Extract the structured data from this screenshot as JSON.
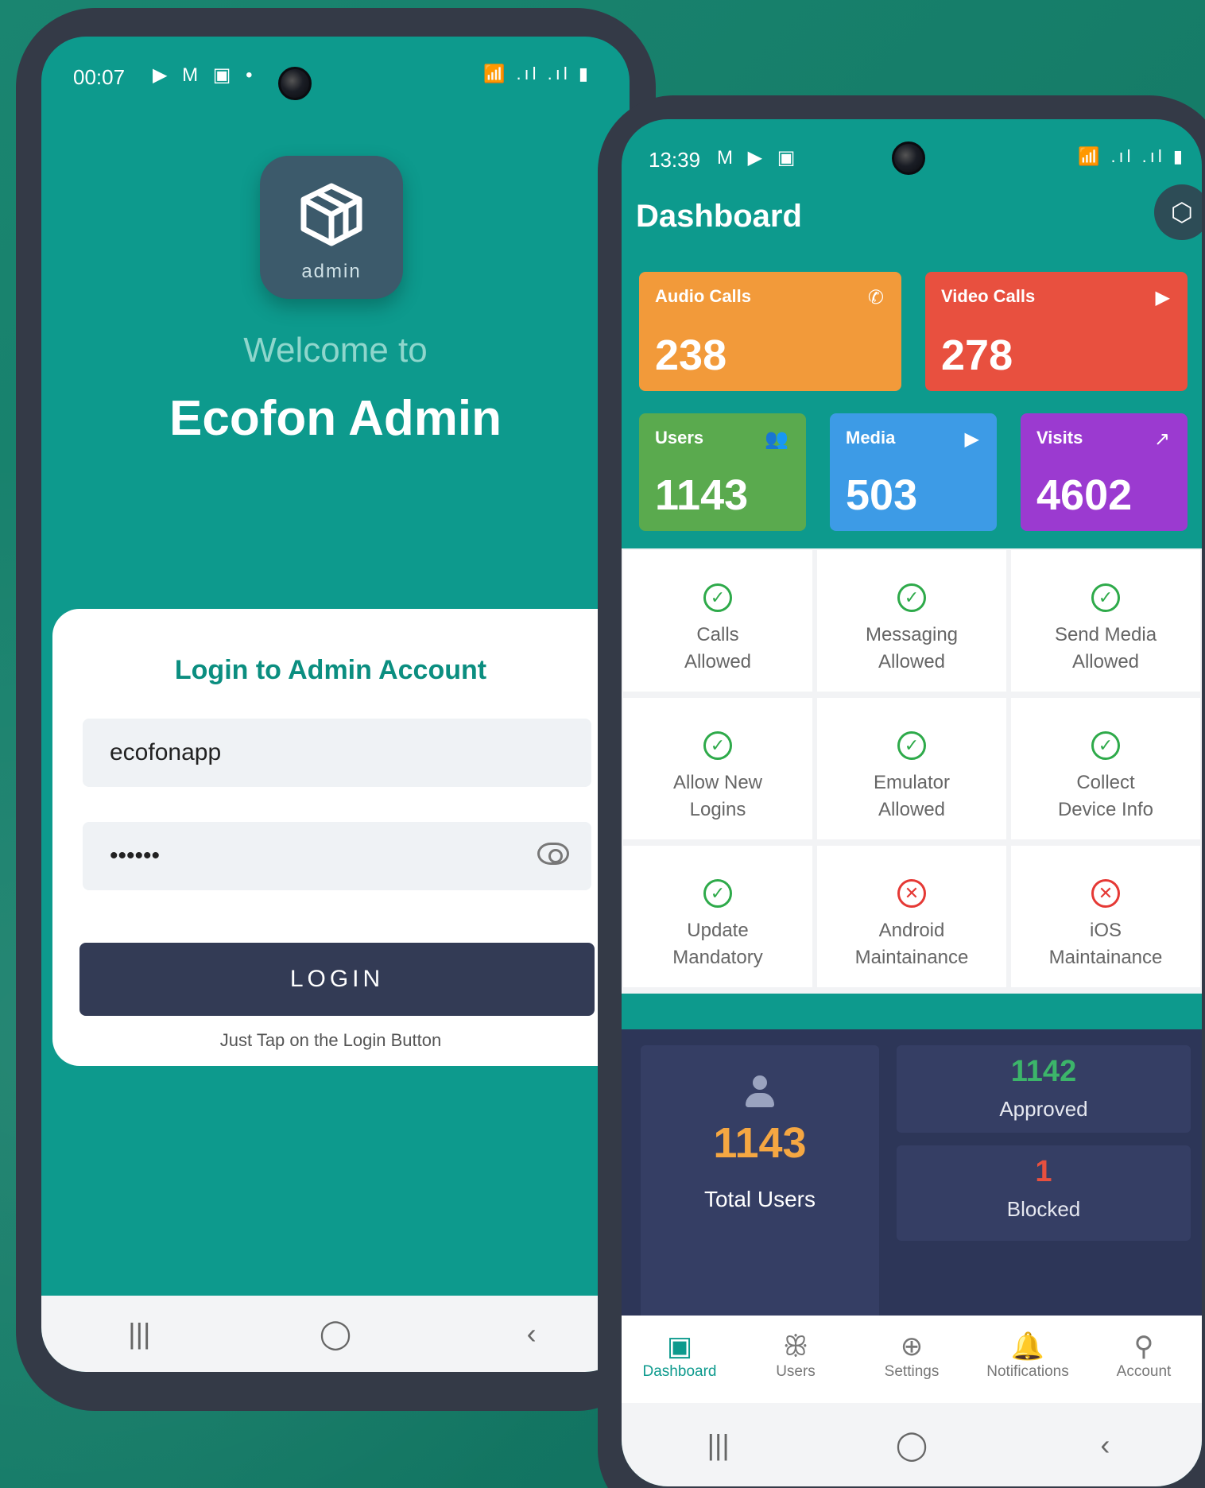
{
  "login_screen": {
    "status": {
      "time": "00:07",
      "icons": "▶ M ▣ •",
      "right": "📶 .ıl .ıl ▮"
    },
    "logo_text": "admin",
    "welcome": "Welcome to",
    "app_name": "Ecofon Admin",
    "card_title": "Login to Admin Account",
    "username_value": "ecofonapp",
    "password_value": "••••••",
    "login_button": "LOGIN",
    "hint": "Just Tap on the Login Button",
    "nav": {
      "recent": "|||",
      "home": "◯",
      "back": "‹"
    }
  },
  "dashboard_screen": {
    "status": {
      "time": "13:39",
      "icons": "M ▶ ▣",
      "right": "📶 .ıl .ıl ▮"
    },
    "title": "Dashboard",
    "stats": [
      {
        "label": "Audio Calls",
        "value": "238",
        "icon": "phone-icon",
        "glyph": "✆",
        "color": "#f29a3a"
      },
      {
        "label": "Video Calls",
        "value": "278",
        "icon": "video-icon",
        "glyph": "▶",
        "color": "#e8503f"
      },
      {
        "label": "Users",
        "value": "1143",
        "icon": "users-icon",
        "glyph": "👥",
        "color": "#5aaa4e"
      },
      {
        "label": "Media",
        "value": "503",
        "icon": "play-icon",
        "glyph": "▶",
        "color": "#3d9be6"
      },
      {
        "label": "Visits",
        "value": "4602",
        "icon": "trending-icon",
        "glyph": "↗",
        "color": "#9b3ad0"
      }
    ],
    "features": [
      {
        "label": "Calls\nAllowed",
        "status": "ok"
      },
      {
        "label": "Messaging\nAllowed",
        "status": "ok"
      },
      {
        "label": "Send Media\nAllowed",
        "status": "ok"
      },
      {
        "label": "Allow New\nLogins",
        "status": "ok"
      },
      {
        "label": "Emulator\nAllowed",
        "status": "ok"
      },
      {
        "label": "Collect\nDevice Info",
        "status": "ok"
      },
      {
        "label": "Update\nMandatory",
        "status": "ok"
      },
      {
        "label": "Android\nMaintainance",
        "status": "bad"
      },
      {
        "label": "iOS\nMaintainance",
        "status": "bad"
      }
    ],
    "summary": {
      "total_value": "1143",
      "total_label": "Total Users",
      "approved_value": "1142",
      "approved_label": "Approved",
      "blocked_value": "1",
      "blocked_label": "Blocked"
    },
    "bottom_nav": [
      {
        "label": "Dashboard",
        "icon": "dashboard-icon",
        "glyph": "▣",
        "active": true
      },
      {
        "label": "Users",
        "icon": "users-icon",
        "glyph": "ꕥ",
        "active": false
      },
      {
        "label": "Settings",
        "icon": "gamepad-icon",
        "glyph": "⊕",
        "active": false
      },
      {
        "label": "Notifications",
        "icon": "bell-icon",
        "glyph": "🔔",
        "active": false
      },
      {
        "label": "Account",
        "icon": "user-icon",
        "glyph": "⚲",
        "active": false
      }
    ],
    "nav": {
      "recent": "|||",
      "home": "◯",
      "back": "‹"
    }
  }
}
